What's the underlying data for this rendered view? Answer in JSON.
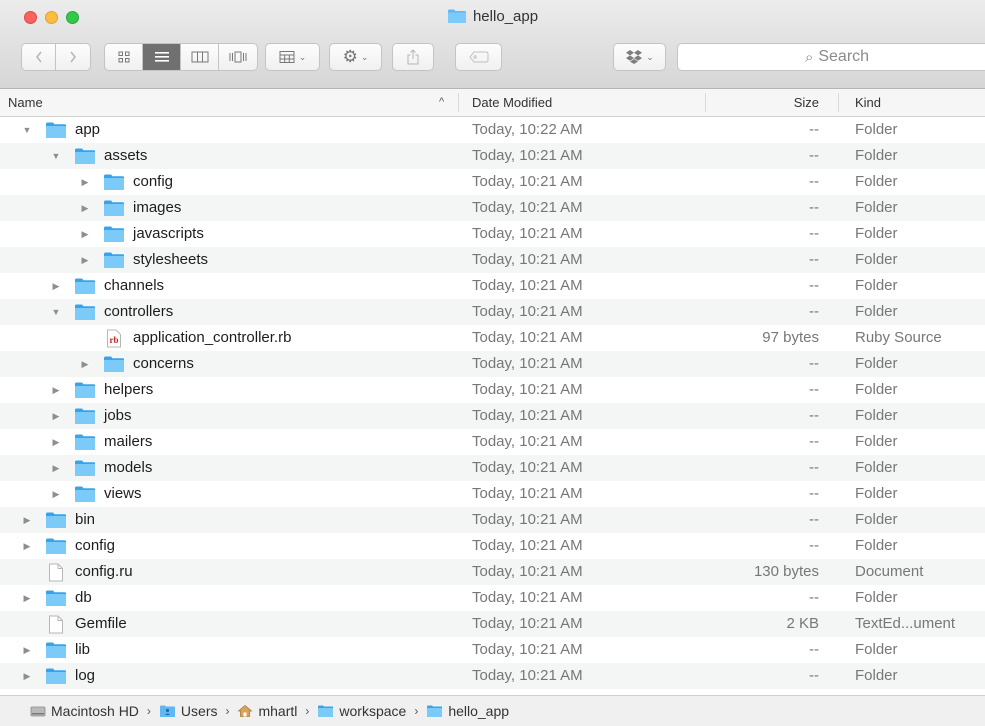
{
  "window": {
    "title": "hello_app"
  },
  "toolbar": {
    "back_icon": "chevron-left",
    "forward_icon": "chevron-right",
    "view_modes": [
      "icon-view",
      "list-view",
      "column-view",
      "cover-flow-view"
    ],
    "active_view": "list-view",
    "arrange_icon": "arrange-grid",
    "action_icon": "gear",
    "share_icon": "share",
    "tag_icon": "tag",
    "dropbox_icon": "dropbox",
    "search_placeholder": "Search"
  },
  "columns": {
    "name": "Name",
    "date": "Date Modified",
    "size": "Size",
    "kind": "Kind",
    "sort_indicator": "^"
  },
  "rows": [
    {
      "name": "app",
      "level": 0,
      "type": "folder",
      "disclosure": "open",
      "date": "Today, 10:22 AM",
      "size": "--",
      "kind": "Folder"
    },
    {
      "name": "assets",
      "level": 1,
      "type": "folder",
      "disclosure": "open",
      "date": "Today, 10:21 AM",
      "size": "--",
      "kind": "Folder"
    },
    {
      "name": "config",
      "level": 2,
      "type": "folder",
      "disclosure": "closed",
      "date": "Today, 10:21 AM",
      "size": "--",
      "kind": "Folder"
    },
    {
      "name": "images",
      "level": 2,
      "type": "folder",
      "disclosure": "closed",
      "date": "Today, 10:21 AM",
      "size": "--",
      "kind": "Folder"
    },
    {
      "name": "javascripts",
      "level": 2,
      "type": "folder",
      "disclosure": "closed",
      "date": "Today, 10:21 AM",
      "size": "--",
      "kind": "Folder"
    },
    {
      "name": "stylesheets",
      "level": 2,
      "type": "folder",
      "disclosure": "closed",
      "date": "Today, 10:21 AM",
      "size": "--",
      "kind": "Folder"
    },
    {
      "name": "channels",
      "level": 1,
      "type": "folder",
      "disclosure": "closed",
      "date": "Today, 10:21 AM",
      "size": "--",
      "kind": "Folder"
    },
    {
      "name": "controllers",
      "level": 1,
      "type": "folder",
      "disclosure": "open",
      "date": "Today, 10:21 AM",
      "size": "--",
      "kind": "Folder"
    },
    {
      "name": "application_controller.rb",
      "level": 2,
      "type": "ruby",
      "disclosure": "none",
      "date": "Today, 10:21 AM",
      "size": "97 bytes",
      "kind": "Ruby Source"
    },
    {
      "name": "concerns",
      "level": 2,
      "type": "folder",
      "disclosure": "closed",
      "date": "Today, 10:21 AM",
      "size": "--",
      "kind": "Folder"
    },
    {
      "name": "helpers",
      "level": 1,
      "type": "folder",
      "disclosure": "closed",
      "date": "Today, 10:21 AM",
      "size": "--",
      "kind": "Folder"
    },
    {
      "name": "jobs",
      "level": 1,
      "type": "folder",
      "disclosure": "closed",
      "date": "Today, 10:21 AM",
      "size": "--",
      "kind": "Folder"
    },
    {
      "name": "mailers",
      "level": 1,
      "type": "folder",
      "disclosure": "closed",
      "date": "Today, 10:21 AM",
      "size": "--",
      "kind": "Folder"
    },
    {
      "name": "models",
      "level": 1,
      "type": "folder",
      "disclosure": "closed",
      "date": "Today, 10:21 AM",
      "size": "--",
      "kind": "Folder"
    },
    {
      "name": "views",
      "level": 1,
      "type": "folder",
      "disclosure": "closed",
      "date": "Today, 10:21 AM",
      "size": "--",
      "kind": "Folder"
    },
    {
      "name": "bin",
      "level": 0,
      "type": "folder",
      "disclosure": "closed",
      "date": "Today, 10:21 AM",
      "size": "--",
      "kind": "Folder"
    },
    {
      "name": "config",
      "level": 0,
      "type": "folder",
      "disclosure": "closed",
      "date": "Today, 10:21 AM",
      "size": "--",
      "kind": "Folder"
    },
    {
      "name": "config.ru",
      "level": 0,
      "type": "document",
      "disclosure": "none",
      "date": "Today, 10:21 AM",
      "size": "130 bytes",
      "kind": "Document"
    },
    {
      "name": "db",
      "level": 0,
      "type": "folder",
      "disclosure": "closed",
      "date": "Today, 10:21 AM",
      "size": "--",
      "kind": "Folder"
    },
    {
      "name": "Gemfile",
      "level": 0,
      "type": "document",
      "disclosure": "none",
      "date": "Today, 10:21 AM",
      "size": "2 KB",
      "kind": "TextEd...ument"
    },
    {
      "name": "lib",
      "level": 0,
      "type": "folder",
      "disclosure": "closed",
      "date": "Today, 10:21 AM",
      "size": "--",
      "kind": "Folder"
    },
    {
      "name": "log",
      "level": 0,
      "type": "folder",
      "disclosure": "closed",
      "date": "Today, 10:21 AM",
      "size": "--",
      "kind": "Folder"
    }
  ],
  "path_bar": [
    {
      "label": "Macintosh HD",
      "icon": "hard-drive"
    },
    {
      "label": "Users",
      "icon": "users-folder"
    },
    {
      "label": "mhartl",
      "icon": "home"
    },
    {
      "label": "workspace",
      "icon": "folder"
    },
    {
      "label": "hello_app",
      "icon": "folder"
    }
  ],
  "colors": {
    "folder_blue": "#5fb8f2",
    "folder_blue_dark": "#3aa3e8",
    "row_alt": "#f4f5f5",
    "ruby_red": "#c8231c"
  }
}
